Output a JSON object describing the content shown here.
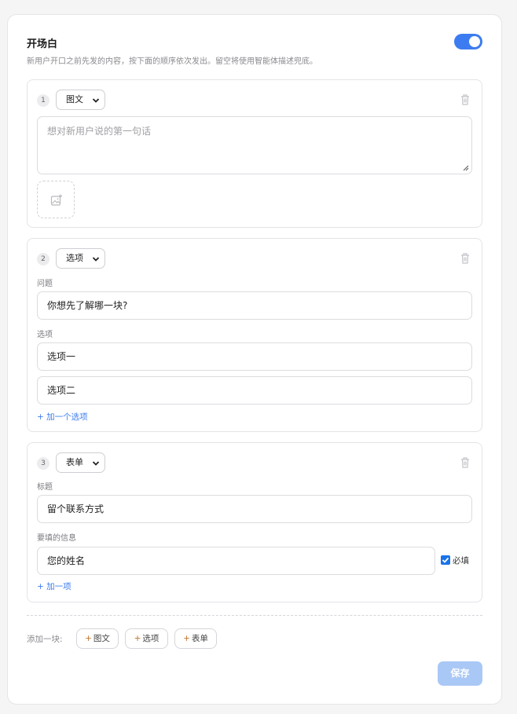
{
  "header": {
    "title": "开场白",
    "description": "新用户开口之前先发的内容，按下面的顺序依次发出。留空将使用智能体描述兜底。",
    "enabled": true
  },
  "blocks": [
    {
      "index": "1",
      "type": "图文",
      "placeholder": "想对新用户说的第一句话"
    },
    {
      "index": "2",
      "type": "选项",
      "question_label": "问题",
      "question_value": "你想先了解哪一块?",
      "options_label": "选项",
      "options": [
        "选项一",
        "选项二"
      ],
      "add_option": "+ 加一个选项"
    },
    {
      "index": "3",
      "type": "表单",
      "title_label": "标题",
      "title_value": "留个联系方式",
      "fields_label": "要填的信息",
      "fields": [
        {
          "value": "您的姓名",
          "required_label": "必填",
          "required": true
        }
      ],
      "add_field": "+ 加一项"
    }
  ],
  "add_block": {
    "label": "添加一块:",
    "buttons": [
      {
        "plus": "+",
        "label": "图文"
      },
      {
        "plus": "+",
        "label": "选项"
      },
      {
        "plus": "+",
        "label": "表单"
      }
    ]
  },
  "save_label": "保存",
  "colors": {
    "accent": "#3d7cf0",
    "save_disabled": "#a9c8f6",
    "link": "#3d7cf0"
  }
}
